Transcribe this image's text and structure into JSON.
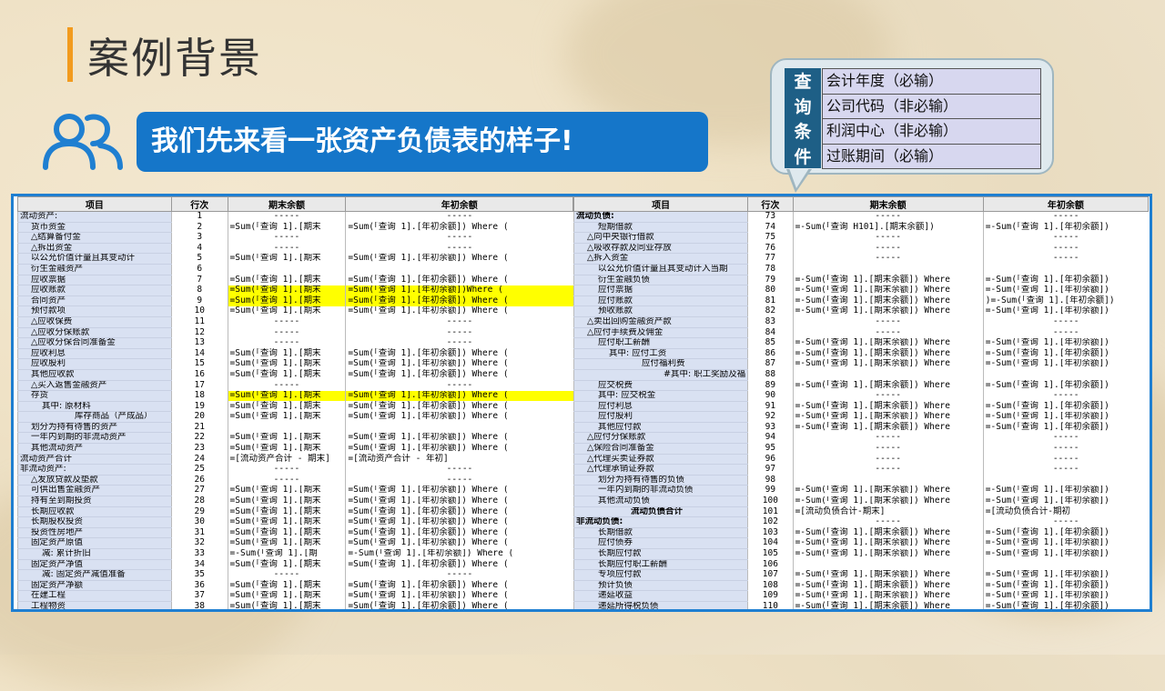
{
  "page_title": "案例背景",
  "banner_text": "我们先来看一张资产负债表的样子!",
  "query_panel": {
    "label_chars": [
      "查",
      "询",
      "条",
      "件"
    ],
    "items": [
      "会计年度（必输）",
      "公司代码（非必输）",
      "利润中心（非必输）",
      "过账期间（必输）"
    ]
  },
  "headers": {
    "item": "项目",
    "row": "行次",
    "end": "期末余额",
    "begin": "年初余额"
  },
  "left_rows": [
    {
      "item": "流动资产:",
      "indent": 0,
      "n": "1",
      "end": "-----",
      "begin": "-----"
    },
    {
      "item": "货币资金",
      "indent": 2,
      "n": "2",
      "end": "=Sum(「查询 1].[期末",
      "begin": "=Sum(「查询 1].[年初余额]) Where ("
    },
    {
      "item": "△结算备付金",
      "indent": 2,
      "n": "3",
      "end": "-----",
      "begin": "-----"
    },
    {
      "item": "△拆出资金",
      "indent": 2,
      "n": "4",
      "end": "-----",
      "begin": "-----"
    },
    {
      "item": "以公允价值计量且其变动计",
      "indent": 2,
      "n": "5",
      "end": "=Sum(「查询 1].[期末",
      "begin": "=Sum(「查询 1].[年初余额]) Where ("
    },
    {
      "item": "衍生金融资产",
      "indent": 2,
      "n": "6",
      "end": "",
      "begin": ""
    },
    {
      "item": "应收票据",
      "indent": 2,
      "n": "7",
      "end": "=Sum(「查询 1].[期末",
      "begin": "=Sum(「查询 1].[年初余额])   Where ("
    },
    {
      "item": "应收账款",
      "indent": 2,
      "n": "8",
      "end": "=Sum(「查询 1].[期末",
      "begin": "=Sum(「查询 1].[年初余额])Where (",
      "hl": true
    },
    {
      "item": "合同资产",
      "indent": 2,
      "n": "9",
      "end": "=Sum(「查询 1].[期末",
      "begin": "=Sum(「查询 1].[年初余额]) Where (",
      "hl": true
    },
    {
      "item": "预付款项",
      "indent": 2,
      "n": "10",
      "end": "=Sum(「查询 1].[期末",
      "begin": "=Sum(「查询 1].[年初余额]) Where ("
    },
    {
      "item": "△应收保费",
      "indent": 2,
      "n": "11",
      "end": "-----",
      "begin": "-----"
    },
    {
      "item": "△应收分保账款",
      "indent": 2,
      "n": "12",
      "end": "-----",
      "begin": "-----"
    },
    {
      "item": "△应收分保合同准备金",
      "indent": 2,
      "n": "13",
      "end": "-----",
      "begin": "-----"
    },
    {
      "item": "应收利息",
      "indent": 2,
      "n": "14",
      "end": "=Sum(「查询 1].[期末",
      "begin": "=Sum(「查询 1].[年初余额])  Where ("
    },
    {
      "item": "应收股利",
      "indent": 2,
      "n": "15",
      "end": "=Sum(「查询 1].[期末",
      "begin": "=Sum(「查询 1].[年初余额]) Where ("
    },
    {
      "item": "其他应收款",
      "indent": 2,
      "n": "16",
      "end": "=Sum(「查询 1].[期末",
      "begin": "=Sum(「查询 1].[年初余额]) Where ("
    },
    {
      "item": "△买入返售金融资产",
      "indent": 2,
      "n": "17",
      "end": "-----",
      "begin": "-----"
    },
    {
      "item": "存货",
      "indent": 2,
      "n": "18",
      "end": "=Sum(「查询 1].[期末",
      "begin": "=Sum(「查询 1].[年初余额]) Where (",
      "hl": true
    },
    {
      "item": "其中: 原材料",
      "indent": 4,
      "n": "19",
      "end": "=Sum(「查询 1].[期末",
      "begin": "=Sum(「查询 1].[年初余额]) Where ("
    },
    {
      "item": "库存商品（产成品）",
      "indent": 10,
      "n": "20",
      "end": "=Sum(「查询 1].[期末",
      "begin": "=Sum(「查询 1].[年初余额]) Where ("
    },
    {
      "item": "划分为持有待售的资产",
      "indent": 2,
      "n": "21",
      "end": "",
      "begin": ""
    },
    {
      "item": "一年内到期的非流动资产",
      "indent": 2,
      "n": "22",
      "end": "=Sum(「查询 1].[期末",
      "begin": "=Sum(「查询 1].[年初余额])  Where ("
    },
    {
      "item": "其他流动资产",
      "indent": 2,
      "n": "23",
      "end": "=Sum(「查询 1].[期末",
      "begin": "=Sum(「查询 1].[年初余额]) Where ("
    },
    {
      "item": "流动资产合计",
      "indent": 0,
      "n": "24",
      "end": "=[流动资产合计 - 期末]",
      "begin": "=[流动资产合计 - 年初]"
    },
    {
      "item": "非流动资产:",
      "indent": 0,
      "n": "25",
      "end": "-----",
      "begin": "-----"
    },
    {
      "item": "△发放贷款及垫款",
      "indent": 2,
      "n": "26",
      "end": "-----",
      "begin": "-----"
    },
    {
      "item": "可供出售金融资产",
      "indent": 2,
      "n": "27",
      "end": "=Sum(「查询 1].[期末",
      "begin": "=Sum(「查询 1].[年初余额]) Where ("
    },
    {
      "item": "持有至到期投资",
      "indent": 2,
      "n": "28",
      "end": "=Sum(「查询 1].[期末",
      "begin": "=Sum(「查询 1].[年初余额]) Where ("
    },
    {
      "item": "长期应收款",
      "indent": 2,
      "n": "29",
      "end": "=Sum(「查询 1].[期末",
      "begin": "=Sum(「查询 1].[年初余额]) Where ("
    },
    {
      "item": "长期股权投资",
      "indent": 2,
      "n": "30",
      "end": "=Sum(「查询 1].[期末",
      "begin": "=Sum(「查询 1].[年初余额]) Where ("
    },
    {
      "item": "投资性房地产",
      "indent": 2,
      "n": "31",
      "end": "=Sum(「查询 1].[期末",
      "begin": "=Sum(「查询 1].[年初余额]) Where ("
    },
    {
      "item": "固定资产原值",
      "indent": 2,
      "n": "32",
      "end": "=Sum(「查询 1].[期末",
      "begin": "=Sum(「查询 1].[年初余额]) Where ("
    },
    {
      "item": "减: 累计折旧",
      "indent": 4,
      "n": "33",
      "end": "=-Sum(「查询 1].[期",
      "begin": "=-Sum(「查询 1].[年初余额]) Where ("
    },
    {
      "item": "固定资产净值",
      "indent": 2,
      "n": "34",
      "end": "=Sum(「查询 1].[期末",
      "begin": "=Sum(「查询 1].[年初余额]) Where ("
    },
    {
      "item": "减: 固定资产减值准备",
      "indent": 4,
      "n": "35",
      "end": "-----",
      "begin": "-----"
    },
    {
      "item": "固定资产净额",
      "indent": 2,
      "n": "36",
      "end": "=Sum(「查询 1].[期末",
      "begin": "=Sum(「查询 1].[年初余额]) Where ("
    },
    {
      "item": "在建工程",
      "indent": 2,
      "n": "37",
      "end": "=Sum(「查询 1].[期末",
      "begin": "=Sum(「查询 1].[年初余额]) Where ("
    },
    {
      "item": "工程物资",
      "indent": 2,
      "n": "38",
      "end": "=Sum(「查询 1].[期末",
      "begin": "=Sum(「查询 1].[年初余额]) Where ("
    }
  ],
  "right_rows": [
    {
      "item": "流动负债:",
      "indent": 0,
      "bold": true,
      "n": "73",
      "end": "-----",
      "begin": "-----"
    },
    {
      "item": "短期借款",
      "indent": 4,
      "n": "74",
      "end": "=-Sum(「查询 H101].[期末余额])",
      "begin": "=-Sum(「查询 1].[年初余额])"
    },
    {
      "item": "△向中央银行借款",
      "indent": 2,
      "n": "75",
      "end": "-----",
      "begin": "-----"
    },
    {
      "item": "△吸收存款及同业存放",
      "indent": 2,
      "n": "76",
      "end": "-----",
      "begin": "-----"
    },
    {
      "item": "△拆入资金",
      "indent": 2,
      "n": "77",
      "end": "-----",
      "begin": "-----"
    },
    {
      "item": "以公允价值计量且其变动计入当期",
      "indent": 4,
      "n": "78",
      "end": "",
      "begin": ""
    },
    {
      "item": "衍生金融负债",
      "indent": 4,
      "n": "79",
      "end": "=-Sum(「查询 1].[期末余额]) Where",
      "begin": "=-Sum(「查询 1].[年初余额])"
    },
    {
      "item": "应付票据",
      "indent": 4,
      "n": "80",
      "end": "=-Sum(「查询 1].[期末余额]) Where",
      "begin": "=-Sum(「查询 1].[年初余额])"
    },
    {
      "item": "应付账款",
      "indent": 4,
      "n": "81",
      "end": "=-Sum(「查询 1].[期末余额]) Where",
      "begin": ")=-Sum(「查询 1].[年初余额])"
    },
    {
      "item": "预收账款",
      "indent": 4,
      "n": "82",
      "end": "=-Sum(「查询 1].[期末余额]) Where",
      "begin": "=-Sum(「查询 1].[年初余额])"
    },
    {
      "item": "△卖出回购金融资产款",
      "indent": 2,
      "n": "83",
      "end": "-----",
      "begin": "-----"
    },
    {
      "item": "△应付手续费及佣金",
      "indent": 2,
      "n": "84",
      "end": "-----",
      "begin": "-----"
    },
    {
      "item": "应付职工薪酬",
      "indent": 4,
      "n": "85",
      "end": "=-Sum(「查询 1].[期末余额]) Where",
      "begin": "=-Sum(「查询 1].[年初余额])"
    },
    {
      "item": "其中: 应付工资",
      "indent": 6,
      "n": "86",
      "end": "=-Sum(「查询 1].[期末余额]) Where",
      "begin": "=-Sum(「查询 1].[年初余额])"
    },
    {
      "item": "应付福利费",
      "indent": 12,
      "n": "87",
      "end": "=-Sum(「查询 1].[期末余额]) Where",
      "begin": "=-Sum(「查询 1].[年初余额])"
    },
    {
      "item": "#其中: 职工奖励及福",
      "indent": 16,
      "n": "88",
      "end": "",
      "begin": ""
    },
    {
      "item": "应交税费",
      "indent": 4,
      "n": "89",
      "end": "=-Sum(「查询 1].[期末余额]) Where",
      "begin": "=-Sum(「查询 1].[年初余额])"
    },
    {
      "item": "其中: 应交税金",
      "indent": 4,
      "n": "90",
      "end": "-----",
      "begin": "-----"
    },
    {
      "item": "应付利息",
      "indent": 4,
      "n": "91",
      "end": "=-Sum(「查询 1].[期末余额]) Where",
      "begin": "=-Sum(「查询 1].[年初余额])"
    },
    {
      "item": "应付股利",
      "indent": 4,
      "n": "92",
      "end": "=-Sum(「查询 1].[期末余额]) Where",
      "begin": "=-Sum(「查询 1].[年初余额])"
    },
    {
      "item": "其他应付款",
      "indent": 4,
      "n": "93",
      "end": "=-Sum(「查询 1].[期末余额]) Where",
      "begin": "=-Sum(「查询 1].[年初余额])"
    },
    {
      "item": "△应付分保账款",
      "indent": 2,
      "n": "94",
      "end": "-----",
      "begin": "-----"
    },
    {
      "item": "△保险合同准备金",
      "indent": 2,
      "n": "95",
      "end": "-----",
      "begin": "-----"
    },
    {
      "item": "△代理买卖证券款",
      "indent": 2,
      "n": "96",
      "end": "-----",
      "begin": "-----"
    },
    {
      "item": "△代理承销证券款",
      "indent": 2,
      "n": "97",
      "end": "-----",
      "begin": "-----"
    },
    {
      "item": "划分为持有待售的负债",
      "indent": 4,
      "n": "98",
      "end": "",
      "begin": ""
    },
    {
      "item": "一年内到期的非流动负债",
      "indent": 4,
      "n": "99",
      "end": "=-Sum(「查询 1].[期末余额]) Where",
      "begin": "=-Sum(「查询 1].[年初余额])"
    },
    {
      "item": "其他流动负债",
      "indent": 4,
      "n": "100",
      "end": "=-Sum(「查询 1].[期末余额]) Where",
      "begin": "=-Sum(「查询 1].[年初余额])"
    },
    {
      "item": "流动负债合计",
      "indent": 10,
      "bold": true,
      "n": "101",
      "end": "=[流动负债合计-期末]",
      "begin": "=[流动负债合计-期初"
    },
    {
      "item": "非流动负债:",
      "indent": 0,
      "bold": true,
      "n": "102",
      "end": "-----",
      "begin": "-----"
    },
    {
      "item": "长期借款",
      "indent": 4,
      "n": "103",
      "end": "=-Sum(「查询 1].[期末余额]) Where",
      "begin": "=-Sum(「查询 1].[年初余额])"
    },
    {
      "item": "应付债券",
      "indent": 4,
      "n": "104",
      "end": "=-Sum(「查询 1].[期末余额]) Where",
      "begin": "=-Sum(「查询 1].[年初余额])"
    },
    {
      "item": "长期应付款",
      "indent": 4,
      "n": "105",
      "end": "=-Sum(「查询 1].[期末余额]) Where",
      "begin": "=-Sum(「查询 1].[年初余额])"
    },
    {
      "item": "长期应付职工薪酬",
      "indent": 4,
      "n": "106",
      "end": "",
      "begin": ""
    },
    {
      "item": "专项应付款",
      "indent": 4,
      "n": "107",
      "end": "=-Sum(「查询 1].[期末余额]) Where",
      "begin": "=-Sum(「查询 1].[年初余额])"
    },
    {
      "item": "预计负债",
      "indent": 4,
      "n": "108",
      "end": "=-Sum(「查询 1].[期末余额]) Where",
      "begin": "=-Sum(「查询 1].[年初余额])"
    },
    {
      "item": "递延收益",
      "indent": 4,
      "n": "109",
      "end": "=-Sum(「查询 1].[期末余额]) Where",
      "begin": "=-Sum(「查询 1].[年初余额])"
    },
    {
      "item": "递延所得税负债",
      "indent": 4,
      "n": "110",
      "end": "=-Sum(「查询 1].[期末余额]) Where",
      "begin": "=-Sum(「查询 1].[年初余额])"
    }
  ],
  "colors": {
    "accent": "#f29b1e",
    "banner": "#1576c9",
    "sheet_border": "#1f7fd1",
    "highlight": "#ffff00",
    "item_bg": "#d9e1f2"
  }
}
